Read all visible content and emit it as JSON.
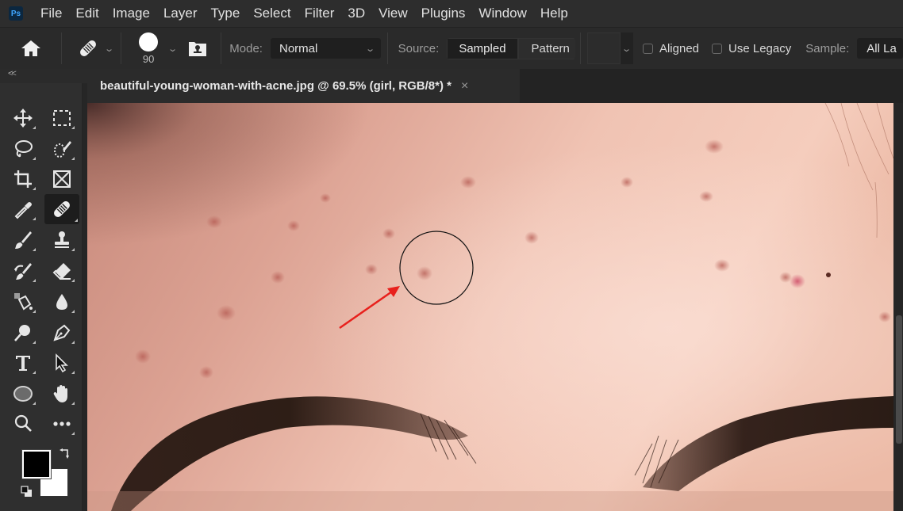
{
  "app": {
    "logo_text": "Ps",
    "menu": [
      "File",
      "Edit",
      "Image",
      "Layer",
      "Type",
      "Select",
      "Filter",
      "3D",
      "View",
      "Plugins",
      "Window",
      "Help"
    ]
  },
  "options_bar": {
    "home_icon": "home-icon",
    "tool_preset_icon": "spot-healing-brush-icon",
    "brush_size": "90",
    "brush_settings_icon": "clone-source-icon",
    "mode_label": "Mode:",
    "mode_value": "Normal",
    "source_label": "Source:",
    "source_options": [
      "Sampled",
      "Pattern"
    ],
    "source_selected": "Sampled",
    "aligned_label": "Aligned",
    "aligned_checked": false,
    "use_legacy_label": "Use Legacy",
    "use_legacy_checked": false,
    "sample_label": "Sample:",
    "sample_value": "All La"
  },
  "panel": {
    "collapse_label": "<<"
  },
  "document": {
    "tab_title": "beautiful-young-woman-with-acne.jpg @ 69.5% (girl, RGB/8*) *",
    "close_label": "×",
    "zoom": "69.5%",
    "layer": "girl",
    "color_mode": "RGB/8*"
  },
  "toolbar": {
    "tools": [
      {
        "name": "move-tool",
        "icon": "move-icon"
      },
      {
        "name": "rectangular-marquee-tool",
        "icon": "marquee-icon"
      },
      {
        "name": "lasso-tool",
        "icon": "lasso-icon"
      },
      {
        "name": "quick-selection-tool",
        "icon": "quick-selection-icon"
      },
      {
        "name": "crop-tool",
        "icon": "crop-icon"
      },
      {
        "name": "frame-tool",
        "icon": "frame-icon"
      },
      {
        "name": "eyedropper-tool",
        "icon": "eyedropper-icon"
      },
      {
        "name": "healing-brush-tool",
        "icon": "bandage-icon",
        "active": true
      },
      {
        "name": "brush-tool",
        "icon": "brush-icon"
      },
      {
        "name": "clone-stamp-tool",
        "icon": "stamp-icon"
      },
      {
        "name": "history-brush-tool",
        "icon": "history-brush-icon"
      },
      {
        "name": "eraser-tool",
        "icon": "eraser-icon"
      },
      {
        "name": "paint-bucket-tool",
        "icon": "paint-bucket-icon"
      },
      {
        "name": "blur-tool",
        "icon": "drop-icon"
      },
      {
        "name": "dodge-tool",
        "icon": "dodge-icon"
      },
      {
        "name": "pen-tool",
        "icon": "pen-icon"
      },
      {
        "name": "type-tool",
        "icon": "type-icon"
      },
      {
        "name": "path-selection-tool",
        "icon": "arrow-icon"
      },
      {
        "name": "ellipse-tool",
        "icon": "ellipse-icon"
      },
      {
        "name": "hand-tool",
        "icon": "hand-icon"
      },
      {
        "name": "zoom-tool",
        "icon": "zoom-icon"
      },
      {
        "name": "edit-toolbar",
        "icon": "more-icon"
      }
    ],
    "foreground_color": "#000000",
    "background_color": "#ffffff"
  },
  "colors": {
    "annotation_arrow": "#e8201c",
    "brush_cursor": "#111111"
  }
}
